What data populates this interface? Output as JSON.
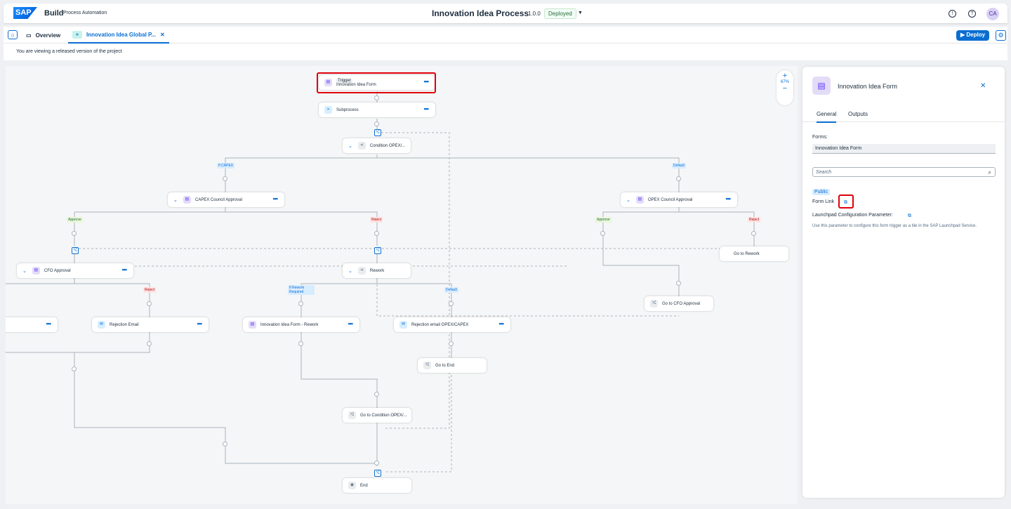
{
  "shell": {
    "logo": "SAP",
    "brand": "Build",
    "brand_sub": "Process Automation",
    "process_title": "Innovation Idea Process",
    "version": "1.0.0",
    "status": "Deployed",
    "avatar": "CA"
  },
  "tabs": {
    "overview": "Overview",
    "active": "Innovation Idea Global P...",
    "deploy": "Deploy"
  },
  "info": "You are viewing a released version of the project",
  "zoom": {
    "level": "67%"
  },
  "nodes": {
    "trigger_label": "Trigger",
    "trigger": "Innovation Idea Form",
    "subprocess": "Subprocess",
    "condition": "Condition OPEX/...",
    "capex": "CAPEX Council Approval",
    "opex": "OPEX Council Approval",
    "cfo": "CFO Approval",
    "rework": "Rework",
    "rejection_email": "Rejection Email",
    "idea_rework": "Innovation Idea Form - Rework",
    "rejection_opex": "Rejection email OPEX/CAPEX",
    "go_rework": "Go to Rework",
    "go_cfo": "Go to CFO Approval",
    "go_end": "Go to End",
    "go_condition": "Go to Condition OPEX/...",
    "end": "End"
  },
  "tags": {
    "if_capex": "If CAPEX",
    "default": "Default",
    "approve": "Approve",
    "reject": "Reject",
    "if_rework": "If Rework Required"
  },
  "panel": {
    "title": "Innovation Idea Form",
    "tab_general": "General",
    "tab_outputs": "Outputs",
    "forms_label": "Forms:",
    "forms_value": "Innovation Idea Form",
    "search_placeholder": "Search",
    "public": "Public",
    "form_link": "Form Link",
    "launchpad": "Launchpad Configuration Parameter:",
    "description": "Use this parameter to configure this form trigger as a tile in the SAP Launchpad Service."
  }
}
